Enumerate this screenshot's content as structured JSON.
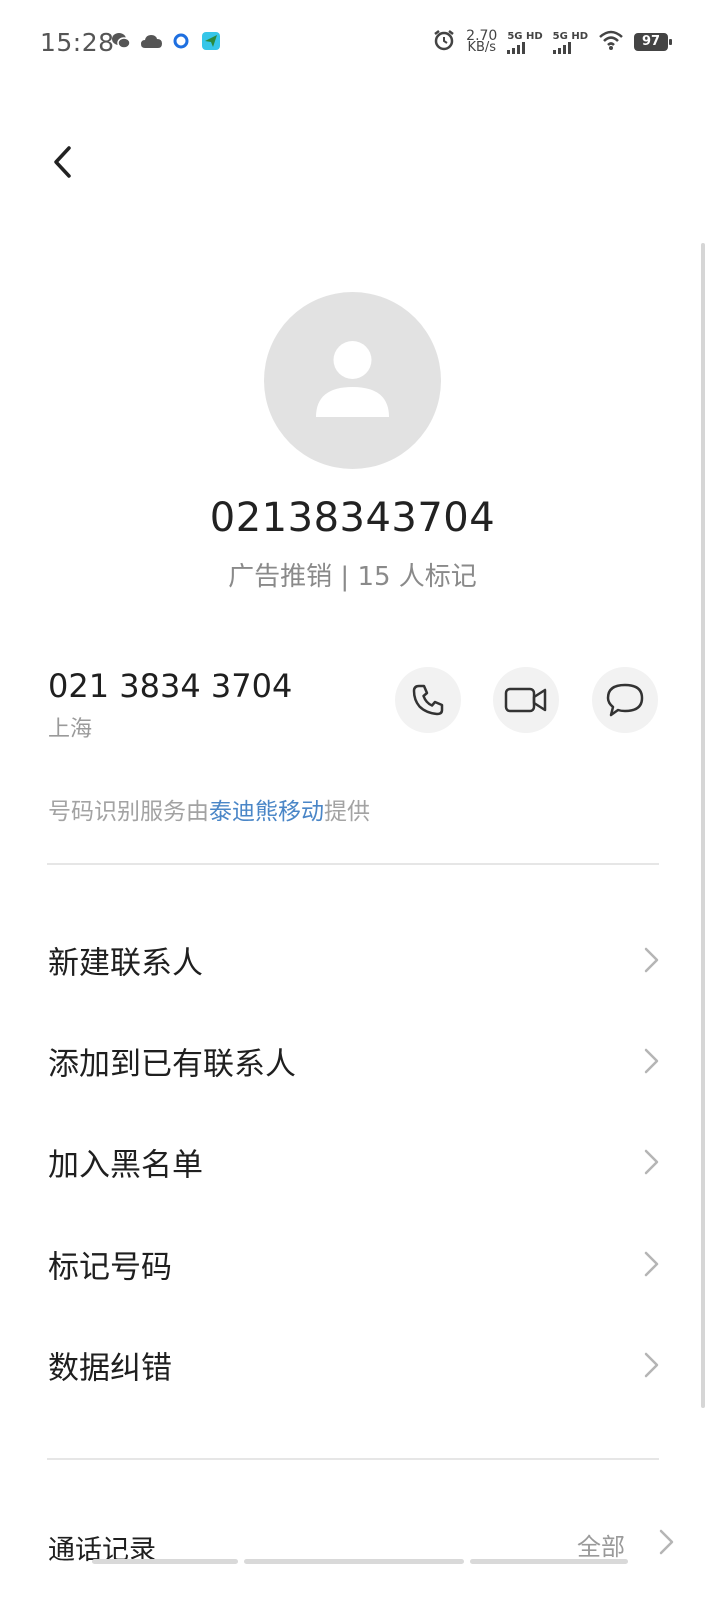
{
  "status_bar": {
    "time": "15:28",
    "network_speed_value": "2.70",
    "network_speed_unit": "KB/s",
    "signal1_label": "5G HD",
    "signal2_label": "5G HD",
    "battery": "97",
    "left_icons": [
      "wechat-icon",
      "cloud-icon",
      "circle-app-icon",
      "send-app-icon"
    ],
    "right_icons": [
      "alarm-icon",
      "signal-icon",
      "signal-icon",
      "wifi-icon",
      "battery-icon"
    ]
  },
  "header": {
    "back_icon": "chevron-left-icon"
  },
  "contact": {
    "avatar_icon": "person-icon",
    "title": "02138343704",
    "tag": "广告推销 | 15 人标记",
    "formatted_number": "021 3834 3704",
    "location": "上海"
  },
  "actions": [
    {
      "name": "call",
      "icon": "phone-icon"
    },
    {
      "name": "video",
      "icon": "video-icon"
    },
    {
      "name": "message",
      "icon": "message-icon"
    }
  ],
  "provider": {
    "prefix": "号码识别服务由",
    "link": "泰迪熊移动",
    "suffix": "提供"
  },
  "menu": {
    "items": [
      {
        "label": "新建联系人"
      },
      {
        "label": "添加到已有联系人"
      },
      {
        "label": "加入黑名单"
      },
      {
        "label": "标记号码"
      },
      {
        "label": "数据纠错"
      }
    ]
  },
  "call_log": {
    "title": "通话记录",
    "filter": "全部"
  },
  "colors": {
    "link": "#4a86c7",
    "secondary_text": "#8a8a8a",
    "avatar_bg": "#e2e2e2",
    "button_bg": "#f2f2f2"
  }
}
